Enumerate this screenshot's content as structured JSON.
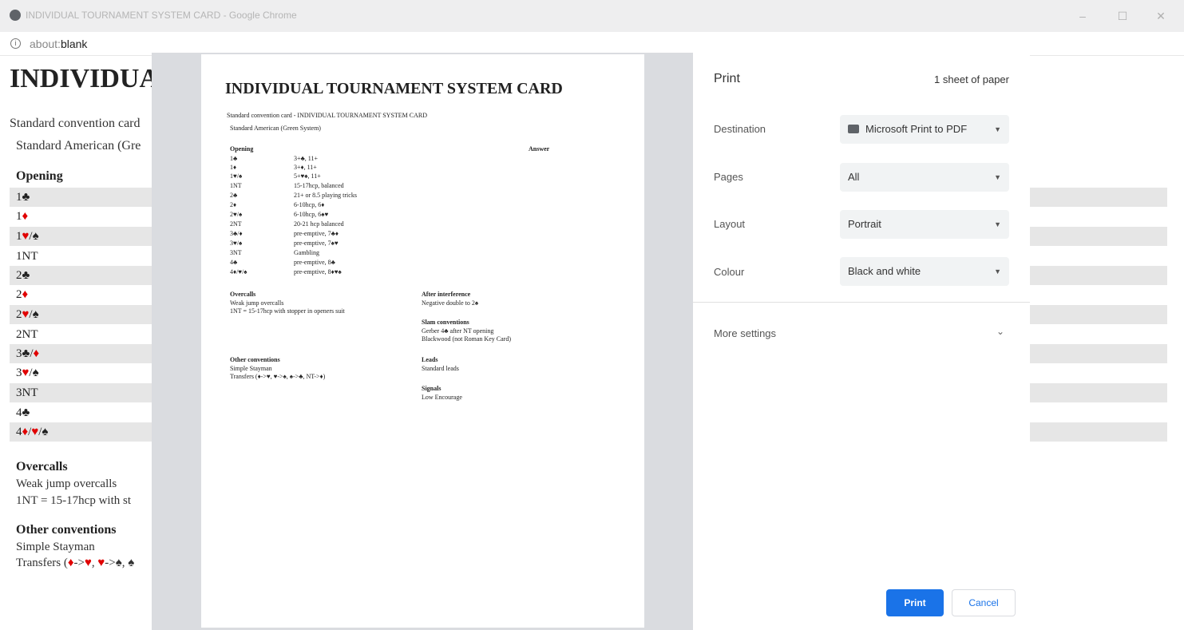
{
  "window": {
    "title": "INDIVIDUAL TOURNAMENT SYSTEM CARD - Google Chrome",
    "minimize": "–",
    "maximize": "☐",
    "close": "✕"
  },
  "addressbar": {
    "scheme": "about:",
    "host": "blank"
  },
  "page": {
    "title": "INDIVIDUAL TOURNAMENT SYSTEM CARD",
    "title_visible": "INDIVIDUA",
    "subtitle": "Standard convention card",
    "system": "Standard American (Gre",
    "opening_head": "Opening",
    "overcalls_head": "Overcalls",
    "overcalls_lines": [
      "Weak jump overcalls",
      "1NT = 15-17hcp with st"
    ],
    "other_head": "Other conventions",
    "other_line1": "Simple Stayman",
    "other_line2_prefix": "Transfers (",
    "other_line2_a": "♦",
    "other_line2_b": "->",
    "other_line2_c": "♥",
    "other_line2_d": ", ",
    "other_line2_e": "♥",
    "other_line2_f": "->♠, ♠"
  },
  "preview": {
    "title": "INDIVIDUAL TOURNAMENT SYSTEM CARD",
    "subtitle": "Standard convention card - INDIVIDUAL TOURNAMENT SYSTEM CARD",
    "system": "Standard American (Green System)",
    "opening_head": "Opening",
    "answer_head": "Answer",
    "rows": [
      {
        "bid": "1♣",
        "meaning": "3+♣, 11+"
      },
      {
        "bid": "1♦",
        "meaning": "3+♦, 11+"
      },
      {
        "bid": "1♥/♠",
        "meaning": "5+♥♠, 11+"
      },
      {
        "bid": "1NT",
        "meaning": "15-17hcp, balanced"
      },
      {
        "bid": "2♣",
        "meaning": "21+ or 8.5 playing tricks"
      },
      {
        "bid": "2♦",
        "meaning": "6-10hcp, 6♦"
      },
      {
        "bid": "2♥/♠",
        "meaning": "6-10hcp, 6♠♥"
      },
      {
        "bid": "2NT",
        "meaning": "20-21 hcp balanced"
      },
      {
        "bid": "3♣/♦",
        "meaning": "pre-emptive, 7♣♦"
      },
      {
        "bid": "3♥/♠",
        "meaning": "pre-emptive, 7♠♥"
      },
      {
        "bid": "3NT",
        "meaning": "Gambling"
      },
      {
        "bid": "4♣",
        "meaning": "pre-emptive, 8♣"
      },
      {
        "bid": "4♦/♥/♠",
        "meaning": "pre-emptive, 8♦♥♠"
      }
    ],
    "overcalls_head": "Overcalls",
    "overcalls_lines": [
      "Weak jump overcalls",
      "1NT = 15-17hcp with stopper in openers suit"
    ],
    "other_head": "Other conventions",
    "other_lines": [
      "Simple Stayman",
      "Transfers (♦->♥, ♥->♠, ♠->♣, NT->♦)"
    ],
    "after_head": "After interference",
    "after_lines": [
      "Negative double to 2♠"
    ],
    "slam_head": "Slam conventions",
    "slam_lines": [
      "Gerber 4♣ after NT opening",
      "Blackwood (not Roman Key Card)"
    ],
    "leads_head": "Leads",
    "leads_lines": [
      "Standard leads"
    ],
    "signals_head": "Signals",
    "signals_lines": [
      "Low Encourage"
    ]
  },
  "print": {
    "header": "Print",
    "sheets": "1 sheet of paper",
    "destination_label": "Destination",
    "destination_value": "Microsoft Print to PDF",
    "pages_label": "Pages",
    "pages_value": "All",
    "layout_label": "Layout",
    "layout_value": "Portrait",
    "colour_label": "Colour",
    "colour_value": "Black and white",
    "more_settings": "More settings",
    "print_button": "Print",
    "cancel_button": "Cancel"
  }
}
